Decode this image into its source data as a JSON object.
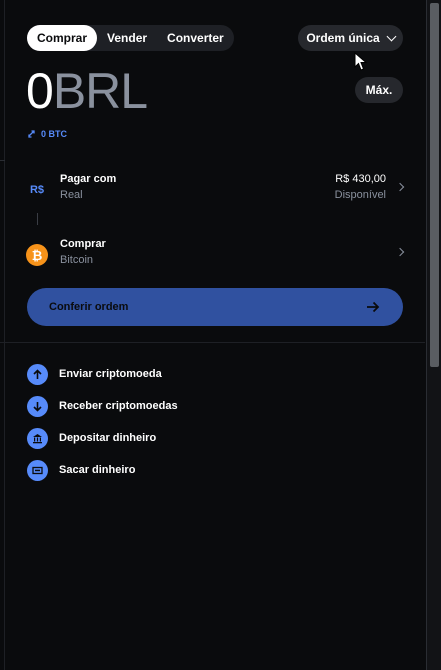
{
  "tabs": [
    {
      "label": "Comprar",
      "active": true
    },
    {
      "label": "Vender",
      "active": false
    },
    {
      "label": "Converter",
      "active": false
    }
  ],
  "order_type": {
    "label": "Ordem única",
    "icon": "chevron-down-icon"
  },
  "amount": {
    "value": "0",
    "currency": "BRL"
  },
  "max_button": {
    "label": "Máx."
  },
  "conversion": {
    "label": "0 BTC",
    "icon": "swap-icon"
  },
  "pay_with": {
    "title": "Pagar com",
    "subtitle": "Real",
    "icon_text": "R$",
    "balance": "R$ 430,00",
    "balance_label": "Disponível"
  },
  "buy_asset": {
    "title": "Comprar",
    "subtitle": "Bitcoin",
    "icon_text": "₿"
  },
  "confirm_button": {
    "label": "Conferir ordem"
  },
  "actions": [
    {
      "label": "Enviar criptomoeda",
      "icon": "arrow-up-icon"
    },
    {
      "label": "Receber criptomoedas",
      "icon": "arrow-down-icon"
    },
    {
      "label": "Depositar dinheiro",
      "icon": "bank-icon"
    },
    {
      "label": "Sacar dinheiro",
      "icon": "cash-icon"
    }
  ],
  "colors": {
    "background": "#0a0b0d",
    "accent": "#578bfa",
    "button_dark": "#26282d",
    "confirm_disabled": "#3051a0",
    "bitcoin": "#f7931a",
    "muted_text": "#8a919e"
  }
}
